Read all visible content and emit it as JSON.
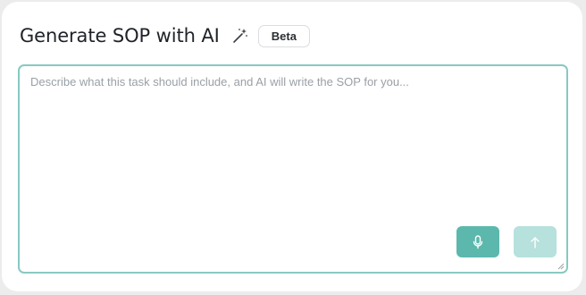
{
  "header": {
    "title": "Generate SOP with AI",
    "badge": "Beta",
    "icon": "magic-wand-icon"
  },
  "editor": {
    "placeholder": "Describe what this task should include, and AI will write the SOP for you...",
    "value": ""
  },
  "actions": {
    "mic_icon": "microphone-icon",
    "send_icon": "arrow-up-icon",
    "send_disabled": true
  },
  "colors": {
    "accent": "#5cb8ad",
    "accent_disabled": "#b6e1dc",
    "border_focus": "#88c9c2"
  }
}
